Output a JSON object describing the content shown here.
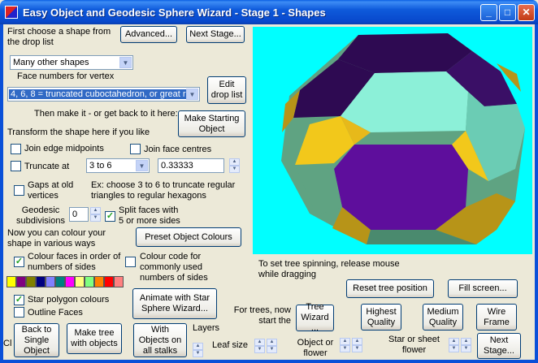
{
  "window": {
    "title": "Easy Object  and Geodesic Sphere Wizard - Stage 1 -  Shapes",
    "min_label": "_",
    "max_label": "□",
    "close_label": "✕"
  },
  "top": {
    "choose_label": "First choose a shape from the drop list",
    "advanced_button": "Advanced...",
    "next_stage_button": "Next Stage...",
    "shape_select": "Many other shapes",
    "face_numbers_label": "Face numbers for vertex",
    "vertex_select": "4, 6, 8 = truncated cuboctahedron, or great rh",
    "edit_button": "Edit drop list",
    "make_label": "Then make it - or get back to it here:",
    "make_button": "Make Starting Object"
  },
  "transform": {
    "label": "Transform the shape here if you like",
    "join_edge": "Join edge midpoints",
    "join_face": "Join face centres",
    "truncate": "Truncate at",
    "truncate_select": "3 to 6",
    "truncate_value": "0.33333",
    "gaps_label": "Gaps at old vertices",
    "example_label": "Ex: choose 3 to 6 to truncate regular triangles to regular hexagons",
    "geodesic_label": "Geodesic subdivisions",
    "geodesic_value": "0",
    "split_label": "Split faces with 5 or more sides"
  },
  "colour": {
    "label": "Now you can colour your shape in various ways",
    "preset_button": "Preset Object Colours",
    "faces_order": "Colour faces in order of numbers of sides",
    "colour_code": "Colour code for commonly used numbers of sides",
    "swatches": [
      "#FFFF00",
      "#800080",
      "#808000",
      "#000080",
      "#8080FF",
      "#008080",
      "#FF00FF",
      "#FFFF80",
      "#80FF80",
      "#FF8000",
      "#FF0000",
      "#FF8080"
    ],
    "star_polygon": "Star polygon colours",
    "outline_faces": "Outline Faces"
  },
  "viewport": {
    "spin_hint": "To set tree spinning, release mouse while dragging",
    "reset_button": "Reset tree position",
    "fill_button": "Fill screen..."
  },
  "bottom": {
    "animate_button": "Animate with Star Sphere Wizard...",
    "for_trees_label": "For trees, now start the",
    "tree_wizard_button": "Tree Wizard ...",
    "high_quality_button": "Highest Quality",
    "medium_quality_button": "Medium Quality",
    "wire_frame_button": "Wire Frame",
    "cl_label": "Cl",
    "back_button": "Back to Single Object",
    "make_tree_button": "Make tree with objects",
    "with_objects_button": "With Objects on all stalks",
    "layers_label": "Layers",
    "leaf_size_label": "Leaf size",
    "object_flower_label": "Object or flower",
    "star_sheet_label": "Star or sheet flower",
    "next_stage_button": "Next Stage..."
  },
  "shape_colors": {
    "square": "#F2C81B",
    "hexagon": "#8CF0D8",
    "octagon": "#5E0E9C",
    "dark_square": "#2E0A52",
    "side": "#5FA382",
    "gold": "#B79418"
  }
}
